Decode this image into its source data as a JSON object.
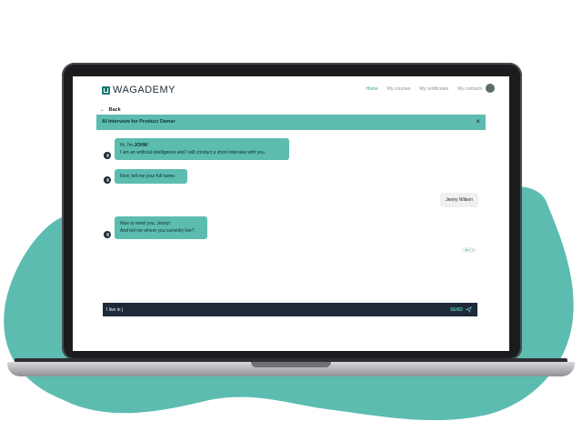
{
  "colors": {
    "accent": "#5cbcb0",
    "dark": "#1e2a3a",
    "blob": "#5cbcb0"
  },
  "nav": {
    "logo_text": "WAGADEMY",
    "links": [
      "Home",
      "My courses",
      "My certificates",
      "My contacts"
    ]
  },
  "back_label": "Back",
  "interview": {
    "title": "AI Interview for Product Owner",
    "close_icon": "close-icon"
  },
  "messages": [
    {
      "from": "bot",
      "line1_prefix": "Hi, I'm ",
      "line1_name": "JOHN!",
      "line2": "I am an artificial intelligence and I will conduct a short interview with you."
    },
    {
      "from": "bot",
      "text": "First, tell me your full name."
    },
    {
      "from": "user",
      "text": "Jenny Wilson"
    },
    {
      "from": "bot",
      "line1": "Nice to meet you, Jenny!",
      "line2": "And tell me where you currently live?"
    }
  ],
  "composer": {
    "value": "I live in |",
    "send_label": "SEND",
    "send_icon": "send-icon"
  }
}
